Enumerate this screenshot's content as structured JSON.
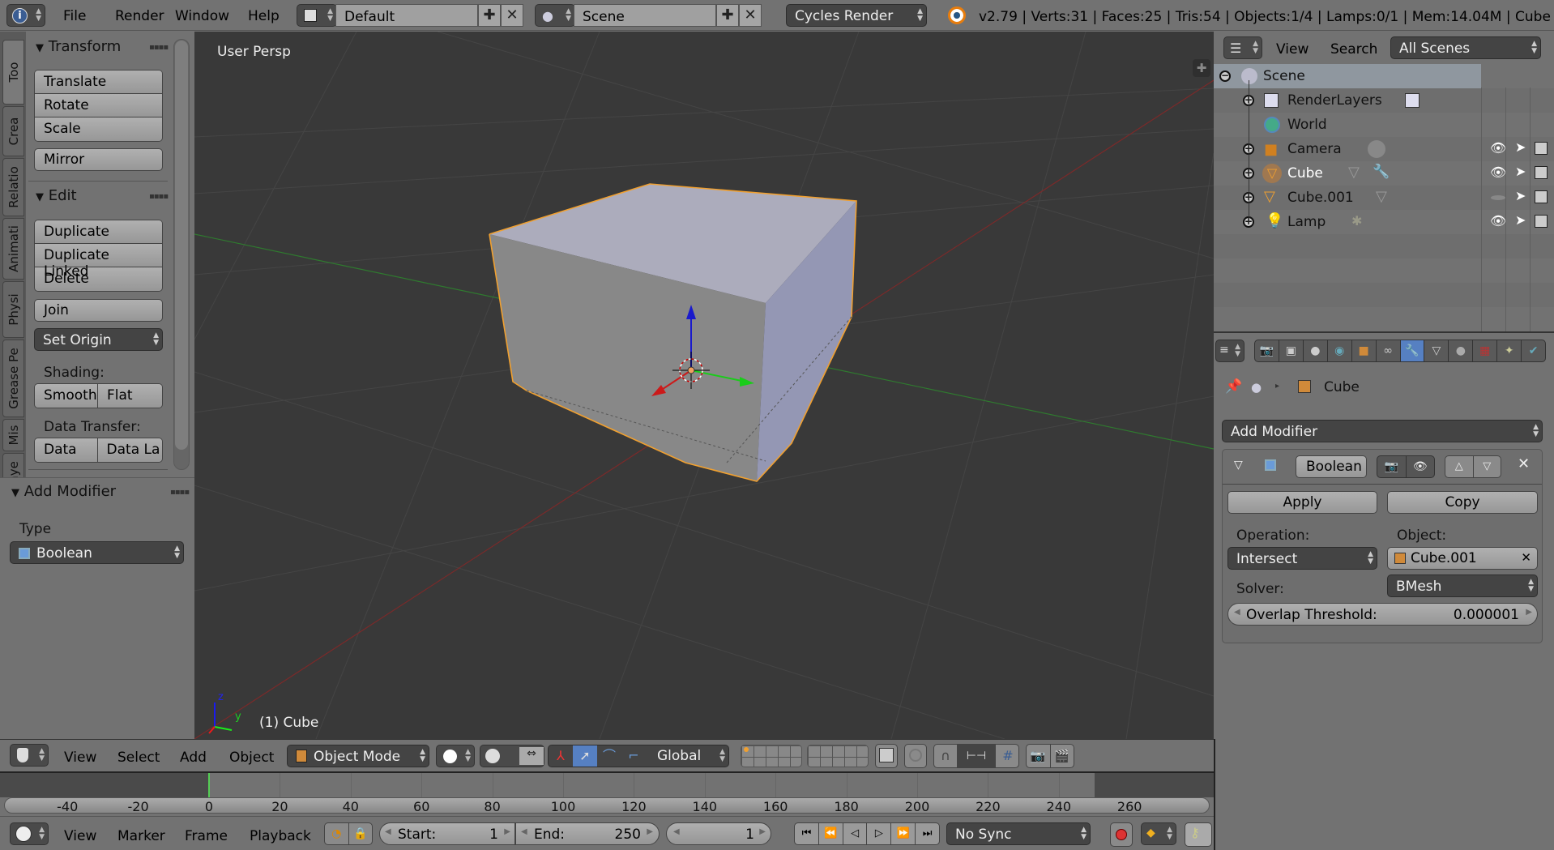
{
  "topbar": {
    "menus": [
      "File",
      "Render",
      "Window",
      "Help"
    ],
    "screen_layout": "Default",
    "scene": "Scene",
    "render_engine": "Cycles Render",
    "status": "v2.79 | Verts:31 | Faces:25 | Tris:54 | Objects:1/4 | Lamps:0/1 | Mem:14.04M | Cube",
    "icons": {
      "info": "info-icon",
      "layout": "screen-layout-icon",
      "scene": "scene-icon",
      "blender": "blender-logo-icon"
    }
  },
  "left_tabs": [
    "Too",
    "Crea",
    "Relatio",
    "Animati",
    "Physi",
    "Grease Pe",
    "Mis",
    "Laye"
  ],
  "tool_shelf": {
    "transform": {
      "title": "Transform",
      "buttons": [
        "Translate",
        "Rotate",
        "Scale"
      ],
      "mirror": "Mirror"
    },
    "edit": {
      "title": "Edit",
      "buttons": [
        "Duplicate",
        "Duplicate Linked",
        "Delete"
      ],
      "join": "Join",
      "set_origin": "Set Origin",
      "shading_label": "Shading:",
      "shading": [
        "Smooth",
        "Flat"
      ],
      "data_transfer_label": "Data Transfer:",
      "data_transfer": [
        "Data",
        "Data La"
      ]
    }
  },
  "operator_panel": {
    "title": "Add Modifier",
    "type_label": "Type",
    "type_value": "Boolean"
  },
  "viewport": {
    "view_label": "User Persp",
    "object_label": "(1) Cube",
    "axis": {
      "x": "x",
      "y": "y",
      "z": "z"
    }
  },
  "view3d_header": {
    "menus": [
      "View",
      "Select",
      "Add",
      "Object"
    ],
    "mode": "Object Mode",
    "orientation": "Global"
  },
  "timeline": {
    "ticks": [
      "-40",
      "-20",
      "0",
      "20",
      "40",
      "60",
      "80",
      "100",
      "120",
      "140",
      "160",
      "180",
      "200",
      "220",
      "240",
      "260"
    ],
    "current_frame_marker": 0,
    "menus": [
      "View",
      "Marker",
      "Frame",
      "Playback"
    ],
    "start_label": "Start:",
    "start": "1",
    "end_label": "End:",
    "end": "250",
    "current_frame": "1",
    "sync": "No Sync"
  },
  "outliner": {
    "menus": [
      "View",
      "Search"
    ],
    "filter": "All Scenes",
    "items": [
      {
        "label": "Scene",
        "icon": "scene-icon"
      },
      {
        "label": "RenderLayers",
        "icon": "render-layers-icon"
      },
      {
        "label": "World",
        "icon": "world-icon"
      },
      {
        "label": "Camera",
        "icon": "camera-icon"
      },
      {
        "label": "Cube",
        "icon": "mesh-object-icon"
      },
      {
        "label": "Cube.001",
        "icon": "mesh-object-icon"
      },
      {
        "label": "Lamp",
        "icon": "lamp-icon"
      }
    ]
  },
  "properties": {
    "breadcrumb_object": "Cube",
    "add_modifier": "Add Modifier",
    "modifier": {
      "name": "Boolean",
      "apply": "Apply",
      "copy": "Copy",
      "operation_label": "Operation:",
      "operation": "Intersect",
      "object_label": "Object:",
      "object": "Cube.001",
      "solver_label": "Solver:",
      "solver": "BMesh",
      "overlap_label": "Overlap Threshold:",
      "overlap_value": "0.000001"
    }
  },
  "colors": {
    "accent": "#5680c2",
    "selection": "#f0a030",
    "viewport_bg": "#393939",
    "panel": "#727272"
  }
}
